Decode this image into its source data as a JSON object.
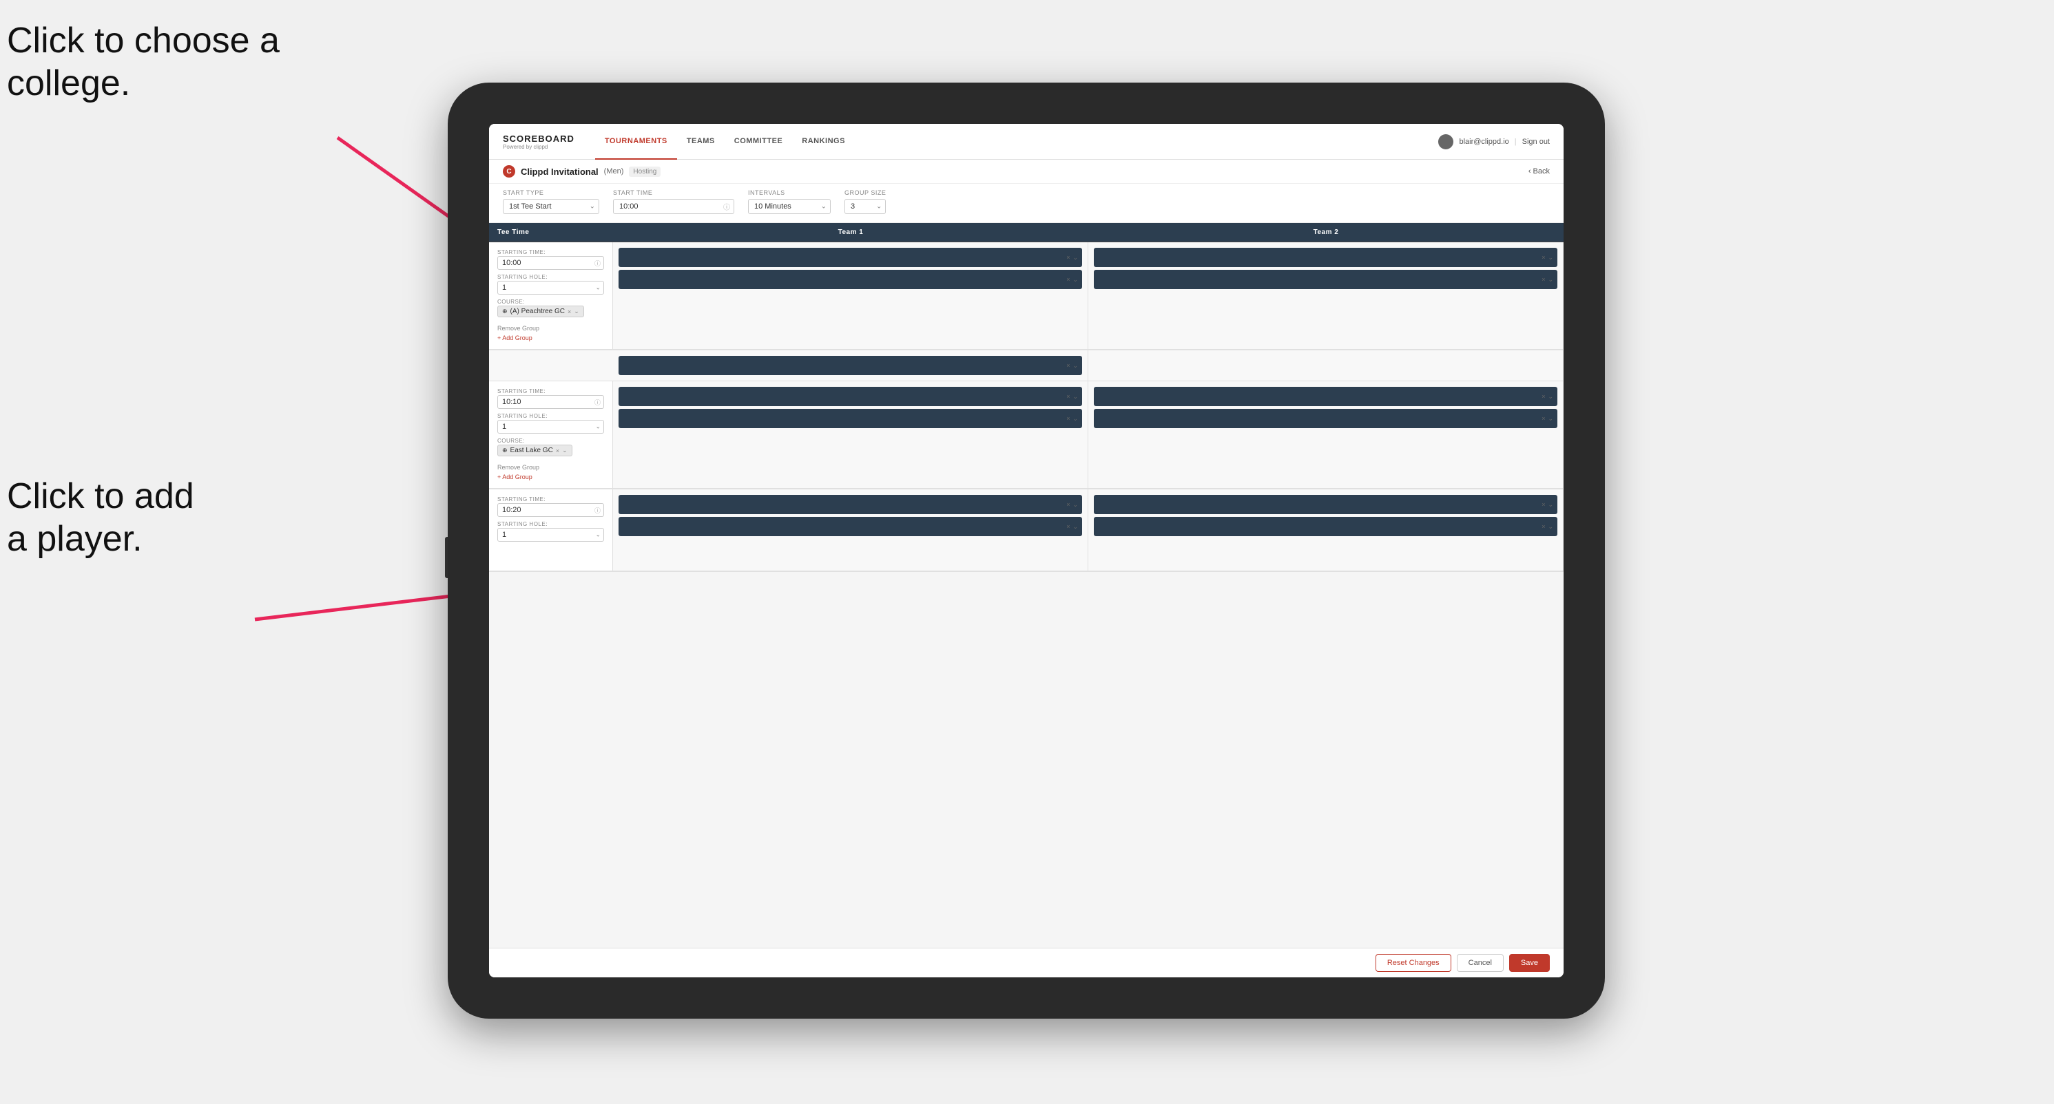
{
  "annotations": {
    "ann1_line1": "Click to choose a",
    "ann1_line2": "college.",
    "ann2_line1": "Click to add",
    "ann2_line2": "a player."
  },
  "nav": {
    "brand": "SCOREBOARD",
    "brand_sub": "Powered by clippd",
    "items": [
      "TOURNAMENTS",
      "TEAMS",
      "COMMITTEE",
      "RANKINGS"
    ],
    "active_item": "TOURNAMENTS",
    "user_email": "blair@clippd.io",
    "sign_out": "Sign out"
  },
  "sub_header": {
    "tournament": "Clippd Invitational",
    "gender": "(Men)",
    "hosting": "Hosting",
    "back": "Back"
  },
  "config": {
    "start_type_label": "Start Type",
    "start_type_value": "1st Tee Start",
    "start_time_label": "Start Time",
    "start_time_value": "10:00",
    "intervals_label": "Intervals",
    "intervals_value": "10 Minutes",
    "group_size_label": "Group Size",
    "group_size_value": "3"
  },
  "table": {
    "headers": [
      "Tee Time",
      "Team 1",
      "Team 2"
    ]
  },
  "groups": [
    {
      "starting_time_label": "STARTING TIME:",
      "starting_time": "10:00",
      "starting_hole_label": "STARTING HOLE:",
      "starting_hole": "1",
      "course_label": "COURSE:",
      "course": "(A) Peachtree GC",
      "remove_group": "Remove Group",
      "add_group": "+ Add Group",
      "team1_slots": 2,
      "team2_slots": 2
    },
    {
      "starting_time_label": "STARTING TIME:",
      "starting_time": "10:10",
      "starting_hole_label": "STARTING HOLE:",
      "starting_hole": "1",
      "course_label": "COURSE:",
      "course": "East Lake GC",
      "remove_group": "Remove Group",
      "add_group": "+ Add Group",
      "team1_slots": 2,
      "team2_slots": 2
    },
    {
      "starting_time_label": "STARTING TIME:",
      "starting_time": "10:20",
      "starting_hole_label": "STARTING HOLE:",
      "starting_hole": "1",
      "course_label": "",
      "course": "",
      "remove_group": "",
      "add_group": "",
      "team1_slots": 2,
      "team2_slots": 2
    }
  ],
  "footer": {
    "reset": "Reset Changes",
    "cancel": "Cancel",
    "save": "Save"
  },
  "colors": {
    "accent": "#c0392b",
    "dark_bg": "#2c3e50",
    "arrow": "#e8265a"
  }
}
